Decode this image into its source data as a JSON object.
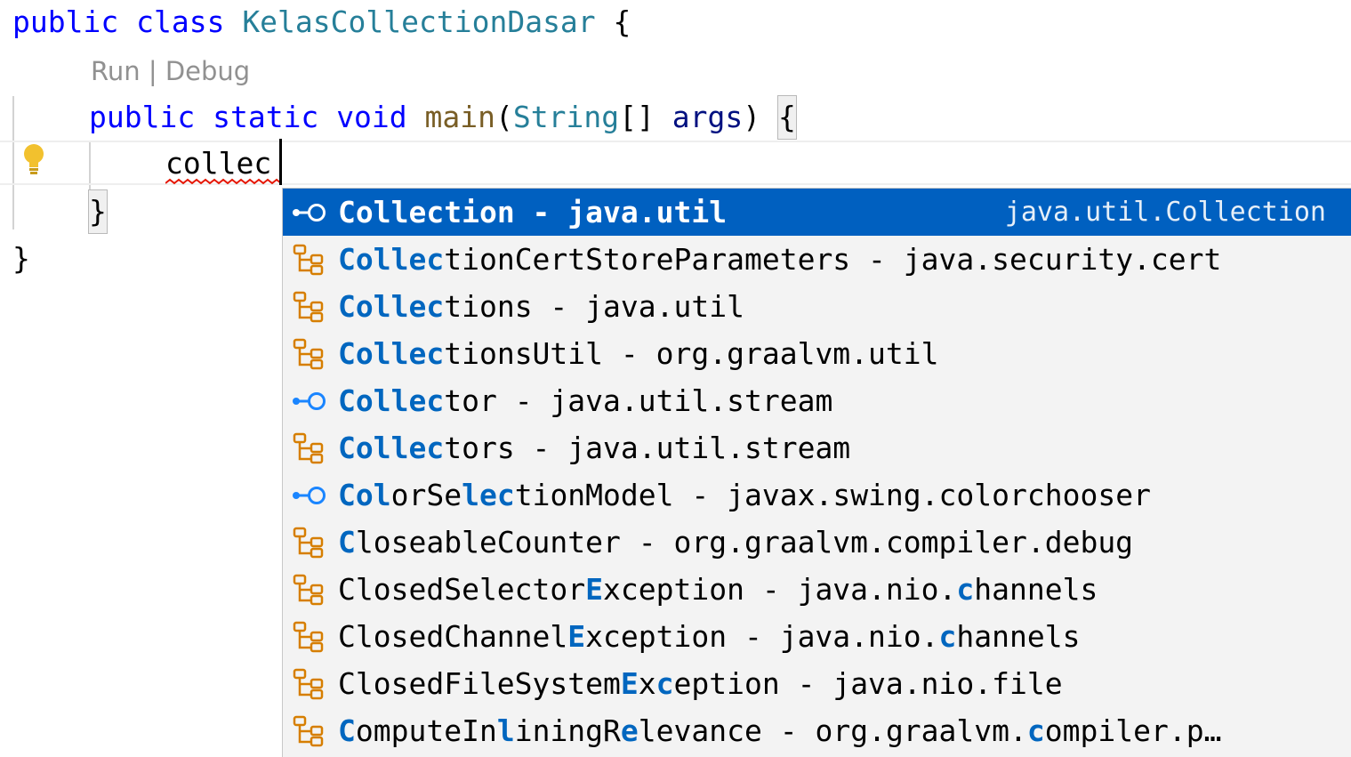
{
  "editor": {
    "class_line": {
      "kw1": "public",
      "kw2": "class",
      "class_name": "KelasCollectionDasar",
      "brace": "{"
    },
    "codelens": {
      "run": "Run",
      "separator": "|",
      "debug": "Debug"
    },
    "main_line": {
      "kw1": "public",
      "kw2": "static",
      "kw3": "void",
      "method": "main",
      "open_paren": "(",
      "param_type": "String",
      "array_brackets": "[]",
      "param_name": "args",
      "close_paren": ")",
      "brace": "{"
    },
    "typed_text": "collec",
    "close_method_brace": "}",
    "close_class_brace": "}",
    "lightbulb_icon": "lightbulb-icon"
  },
  "suggestions": {
    "selected_index": 0,
    "colors": {
      "selected_bg": "#0060c0",
      "match_highlight": "#0066bf",
      "class_icon": "#d67e00",
      "interface_icon": "#1a85ff"
    },
    "items": [
      {
        "icon": "interface-icon",
        "match": "Collec",
        "rest": "tion - java.util",
        "detail": "java.util.Collection"
      },
      {
        "icon": "class-icon",
        "match": "Collec",
        "rest": "tionCertStoreParameters - java.security.cert"
      },
      {
        "icon": "class-icon",
        "match": "Collec",
        "rest": "tions - java.util"
      },
      {
        "icon": "class-icon",
        "match": "Collec",
        "rest": "tionsUtil - org.graalvm.util"
      },
      {
        "icon": "interface-icon",
        "match": "Collec",
        "rest": "tor - java.util.stream"
      },
      {
        "icon": "class-icon",
        "match": "Collec",
        "rest": "tors - java.util.stream"
      },
      {
        "icon": "interface-icon",
        "parts": [
          [
            "Col",
            "m"
          ],
          [
            "orSe",
            ""
          ],
          [
            "lec",
            "m"
          ],
          [
            "tionModel - javax.swing.colorchooser",
            ""
          ]
        ]
      },
      {
        "icon": "class-icon",
        "parts": [
          [
            "C",
            "m"
          ],
          [
            "loseableCounter - org.graalvm.compiler.debug",
            ""
          ]
        ]
      },
      {
        "icon": "class-icon",
        "parts": [
          [
            "ClosedSelector",
            ""
          ],
          [
            "E",
            "m"
          ],
          [
            "xception - java.nio.",
            ""
          ],
          [
            "c",
            "m"
          ],
          [
            "hannels",
            ""
          ]
        ]
      },
      {
        "icon": "class-icon",
        "parts": [
          [
            "ClosedChannel",
            ""
          ],
          [
            "E",
            "m"
          ],
          [
            "xception - java.nio.",
            ""
          ],
          [
            "c",
            "m"
          ],
          [
            "hannels",
            ""
          ]
        ]
      },
      {
        "icon": "class-icon",
        "parts": [
          [
            "ClosedFileSystem",
            ""
          ],
          [
            "E",
            "m"
          ],
          [
            "x",
            ""
          ],
          [
            "c",
            "m"
          ],
          [
            "eption - java.nio.file",
            ""
          ]
        ]
      },
      {
        "icon": "class-icon",
        "parts": [
          [
            "C",
            "m"
          ],
          [
            "omputeIn",
            ""
          ],
          [
            "l",
            "m"
          ],
          [
            "iningR",
            ""
          ],
          [
            "e",
            "m"
          ],
          [
            "levance - org.graalvm.",
            ""
          ],
          [
            "c",
            "m"
          ],
          [
            "ompiler.p…",
            ""
          ]
        ]
      }
    ]
  }
}
